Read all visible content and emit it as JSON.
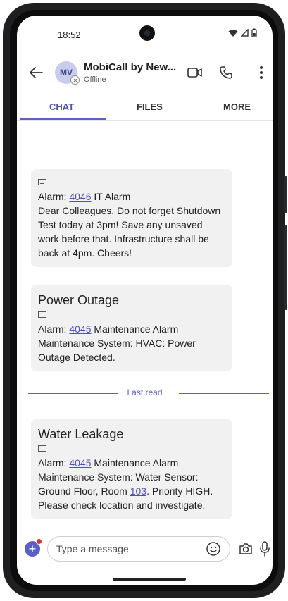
{
  "status_bar": {
    "time": "18:52",
    "icons": [
      "wifi-icon",
      "signal-icon",
      "battery-icon"
    ]
  },
  "header": {
    "avatar_initials": "MV",
    "contact_name": "MobiCall by New...",
    "contact_status": "Offline",
    "icons": [
      "back-arrow-icon",
      "video-call-icon",
      "phone-call-icon",
      "more-options-icon"
    ]
  },
  "tabs": [
    {
      "label": "CHAT",
      "active": true
    },
    {
      "label": "FILES",
      "active": false
    },
    {
      "label": "MORE",
      "active": false
    }
  ],
  "messages": [
    {
      "title": "",
      "alarm_prefix": "Alarm: ",
      "alarm_id": "4046",
      "alarm_type": " IT Alarm",
      "body": "Dear Colleagues. Do not forget Shutdown Test today at 3pm! Save any unsaved work before that. Infrastructure shall be back at 4pm. Cheers!"
    },
    {
      "title": "Power Outage",
      "alarm_prefix": "Alarm: ",
      "alarm_id": "4045",
      "alarm_type": " Maintenance Alarm",
      "body": "Maintenance System: HVAC: Power Outage Detected."
    },
    {
      "title": "Water Leakage",
      "alarm_prefix": "Alarm: ",
      "alarm_id": "4045",
      "alarm_type": " Maintenance Alarm",
      "body_before_room": "Maintenance System: Water Sensor: Ground Floor, Room ",
      "room": "103",
      "body_after_room": ". Priority HIGH. Please check location and investigate."
    }
  ],
  "divider": {
    "label": "Last read"
  },
  "compose": {
    "placeholder": "Type a message",
    "icons": [
      "add-icon",
      "emoji-icon",
      "camera-icon",
      "microphone-icon"
    ]
  },
  "colors": {
    "accent": "#5b5fc7",
    "link": "#4f52b2",
    "bubble": "#f1f1f1",
    "notification": "#d13438"
  }
}
